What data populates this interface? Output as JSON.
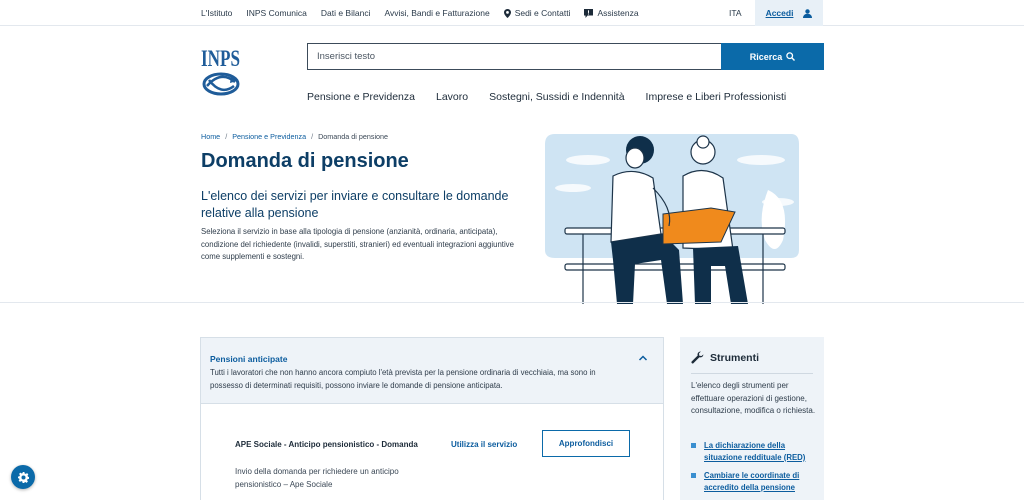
{
  "topbar": {
    "links": [
      {
        "label": "L'Istituto",
        "icon": ""
      },
      {
        "label": "INPS Comunica",
        "icon": ""
      },
      {
        "label": "Dati e Bilanci",
        "icon": ""
      },
      {
        "label": "Avvisi, Bandi e Fatturazione",
        "icon": ""
      },
      {
        "label": "Sedi e Contatti",
        "icon": "map-pin-icon"
      },
      {
        "label": "Assistenza",
        "icon": "chat-icon"
      }
    ],
    "language": "ITA",
    "login_label": "Accedi",
    "login_icon": "user-icon"
  },
  "header": {
    "logo_text": "INPS",
    "search_placeholder": "Inserisci testo",
    "search_button": "Ricerca",
    "nav": [
      "Pensione e Previdenza",
      "Lavoro",
      "Sostegni, Sussidi e Indennità",
      "Imprese e Liberi Professionisti"
    ]
  },
  "hero": {
    "breadcrumb": [
      "Home",
      "Pensione e Previdenza",
      "Domanda di pensione"
    ],
    "title": "Domanda di pensione",
    "subtitle": "L'elenco dei servizi per inviare e consultare le domande relative alla pensione",
    "intro": "Seleziona il servizio in base alla tipologia di pensione (anzianità, ordinaria, anticipata), condizione del richiedente (invalidi, superstiti, stranieri) ed eventuali integrazioni aggiuntive come supplementi e sostegni."
  },
  "accordion": {
    "title": "Pensioni anticipate",
    "description": "Tutti i lavoratori che non hanno ancora compiuto l'età prevista per la pensione ordinaria di vecchiaia, ma sono in possesso di determinati requisiti, possono inviare le domande di pensione anticipata.",
    "service": {
      "title": "APE Sociale - Anticipo pensionistico - Domanda",
      "use_label": "Utilizza il servizio",
      "more_label": "Approfondisci",
      "description": "Invio della domanda per richiedere un anticipo pensionistico – Ape Sociale"
    }
  },
  "tools": {
    "title": "Strumenti",
    "description": "L'elenco degli strumenti per effettuare operazioni di gestione, consultazione, modifica o richiesta.",
    "items": [
      "La dichiarazione della situazione reddituale (RED)",
      "Cambiare le coordinate di accredito della pensione"
    ]
  },
  "colors": {
    "brand": "#0b6aa9",
    "title": "#0d3e66",
    "accent_orange": "#f08a1c",
    "panel_bg": "#eef3f8"
  }
}
